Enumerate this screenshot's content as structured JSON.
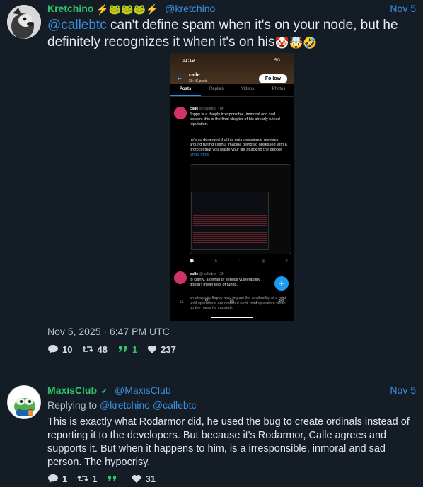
{
  "tweets": [
    {
      "fullname": "Kretchino",
      "name_emojis": "⚡🐸🐸🐸⚡",
      "handle": "@kretchino",
      "date": "Nov 5",
      "mention": "@callebtc",
      "text": " can't define spam when it's on your node, but he definitely recognizes it when it's on his",
      "text_emojis": "🤡🤯🤣",
      "timestamp": "Nov 5, 2025 · 6:47 PM UTC",
      "replies": "10",
      "retweets": "48",
      "quotes": "1",
      "likes": "237",
      "media": {
        "status_time": "11:19",
        "status_signal": "5G",
        "profile_name": "calle",
        "profile_posts": "29.4K posts",
        "follow_label": "Follow",
        "tabs": [
          "Posts",
          "Replies",
          "Videos",
          "Photos"
        ],
        "post1_author": "calle",
        "post1_handle": "@callebtc · 8h",
        "post1_text": "floppy is a deeply irresponsible, immoral and sad person. this is the final chapter of his already ruined reputation.",
        "post1_text2": "he's so deranged that his entire existence revolves around hating cashu. imagine being so obsessed with a protocol that you waste your life attacking the people",
        "show_more": "Show more",
        "post2_author": "calle",
        "post2_handle": "@callebtc · 3h",
        "post2_text": "to clarify, a denial of service vulnerability doesn't mean loss of funds.",
        "post2_text2": "an attack by floppy may impact the availability of a mint until operations are restored (until mint operators clean up the mess he caused)."
      }
    },
    {
      "fullname": "MaxisClub",
      "verified": "✔",
      "handle": "@MaxisClub",
      "date": "Nov 5",
      "reply_prefix": "Replying to",
      "reply_to": [
        "@kretchino",
        "@callebtc"
      ],
      "text": "This is exactly what Rodarmor did, he used the bug to create ordinals instead of reporting it to the developers. But because it's Rodarmor, Calle agrees and supports it. But when it happens to him, is a irresponsible, inmoral and sad person. The hypocrisy.",
      "replies": "1",
      "retweets": "1",
      "quotes": "",
      "likes": "31"
    }
  ],
  "colors": {
    "background": "#141d26",
    "name_green": "#2fc26a",
    "link_blue": "#3b8ee0"
  }
}
